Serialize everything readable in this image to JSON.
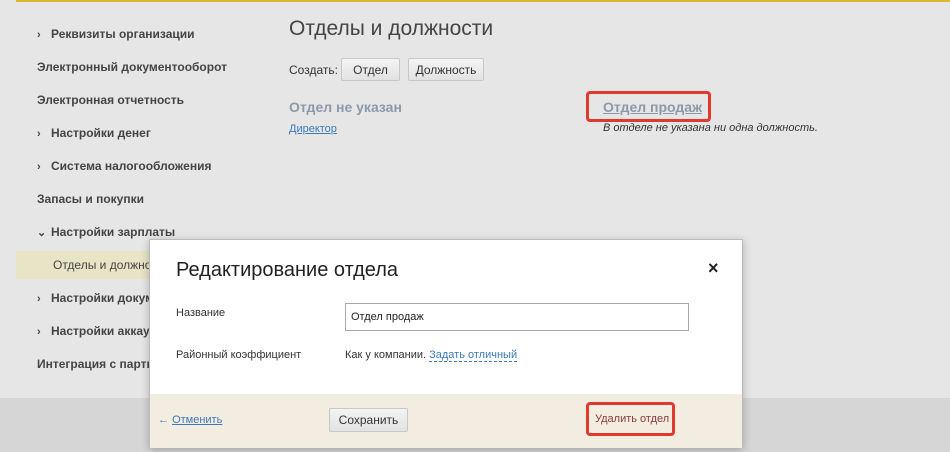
{
  "sidebar": {
    "items": [
      {
        "label": "Реквизиты организации",
        "chevron": "›"
      },
      {
        "label": "Электронный документооборот"
      },
      {
        "label": "Электронная отчетность"
      },
      {
        "label": "Настройки денег",
        "chevron": "›"
      },
      {
        "label": "Система налогообложения",
        "chevron": "›"
      },
      {
        "label": "Запасы и покупки"
      },
      {
        "label": "Настройки зарплаты",
        "chevron": "⌄"
      },
      {
        "label": "Отделы и должности"
      },
      {
        "label": "Настройки документов",
        "chevron": "›"
      },
      {
        "label": "Настройки аккаунта",
        "chevron": "›"
      },
      {
        "label": "Интеграция с партнерами"
      }
    ]
  },
  "main": {
    "title": "Отделы и должности",
    "create_label": "Создать:",
    "btn_dept": "Отдел",
    "btn_position": "Должность",
    "no_dept": "Отдел не указан",
    "director": "Директор",
    "sales_dept": "Отдел продаж",
    "no_positions": "В отделе не указана ни одна должность."
  },
  "modal": {
    "title": "Редактирование отдела",
    "close": "×",
    "name_label": "Название",
    "name_value": "Отдел продаж",
    "coef_label": "Районный коэффициент",
    "coef_value": "Как у компании.",
    "coef_link": "Задать отличный",
    "cancel_arrow": "←",
    "cancel": "Отменить",
    "save": "Сохранить",
    "delete": "Удалить отдел"
  }
}
